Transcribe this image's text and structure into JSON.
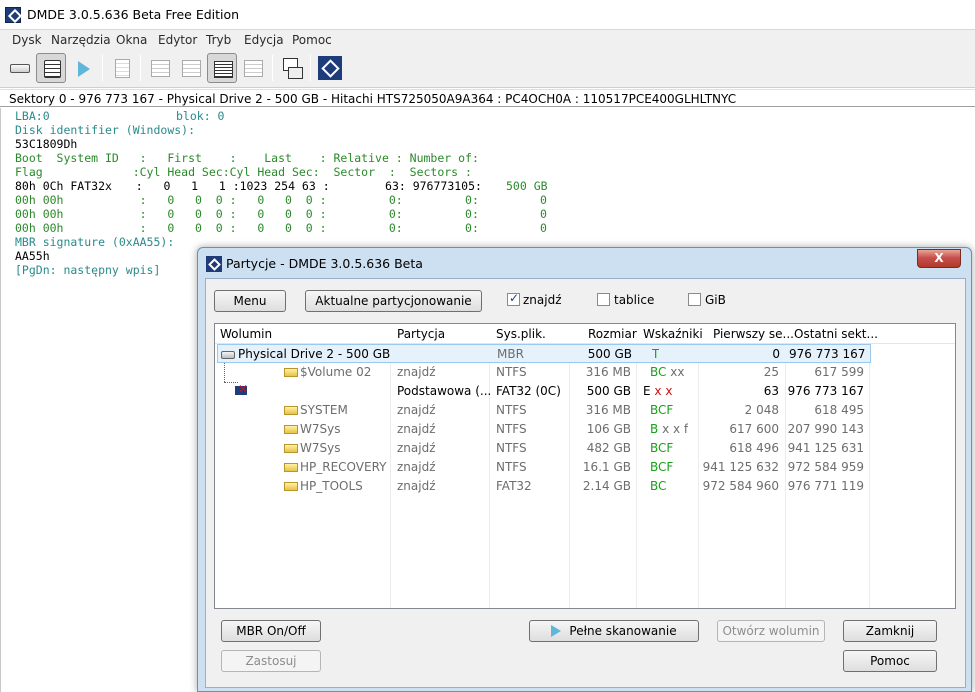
{
  "window": {
    "title": "DMDE 3.0.5.636 Beta Free Edition"
  },
  "menu": [
    "Dysk",
    "Narzędzia",
    "Okna",
    "Edytor",
    "Tryb",
    "Edycja",
    "Pomoc"
  ],
  "toolbar": {
    "icons": [
      "drive-icon",
      "view-lines-icon",
      "play-icon",
      "document-icon",
      "grid-icon",
      "grid-icon",
      "table-view-icon",
      "search-grid-icon",
      "copy-icon",
      "dmde-logo-icon"
    ]
  },
  "sector_bar": "Sektory 0 - 976 773 167 - Physical Drive 2 - 500 GB - Hitachi HTS725050A9A364 : PC4OCH0A : 110517PCE400GLHLTNYC",
  "hex": {
    "l1a": "LBA:0",
    "l1b": "blok: 0",
    "l2": "Disk identifier (Windows):",
    "l3": "53C1809Dh",
    "l4": "Boot  System ID   :   First    :    Last    : Relative : Number of:",
    "l5": "Flag             :Cyl Head Sec:Cyl Head Sec:  Sector  :  Sectors :",
    "l6a": "80h 0Ch FAT32x",
    "l6b": "   :   0   1   1 :1023 254 63 :        63: 976773105:",
    "l6c": "500 GB",
    "l7": "00h 00h           :   0   0  0 :   0   0  0 :         0:         0:",
    "l7c": "0",
    "l8": "00h 00h           :   0   0  0 :   0   0  0 :         0:         0:",
    "l8c": "0",
    "l9": "00h 00h           :   0   0  0 :   0   0  0 :         0:         0:",
    "l9c": "0",
    "l10": "MBR signature (0xAA55):",
    "l11": "AA55h",
    "l12": "[PgDn: następny wpis]"
  },
  "dialog": {
    "title": "Partycje - DMDE 3.0.5.636 Beta",
    "close": "X",
    "menu_btn": "Menu",
    "current_btn": "Aktualne partycjonowanie",
    "chk_find": {
      "label": "znajdź",
      "checked": true
    },
    "chk_tables": {
      "label": "tablice",
      "checked": false
    },
    "chk_gib": {
      "label": "GiB",
      "checked": false
    },
    "columns": [
      "Wolumin",
      "Partycja",
      "Sys.plik.",
      "Rozmiar",
      "Wskaźniki",
      "Pierwszy se...",
      "Ostatni sekt..."
    ],
    "rows": [
      {
        "vol": "Physical Drive 2 - 500 GB - ...",
        "part": "",
        "fs": "MBR",
        "size": "500 GB",
        "flags": "T",
        "first": "0",
        "last": "976 773 167"
      },
      {
        "vol": "$Volume 02",
        "part": "znajdź",
        "fs": "NTFS",
        "size": "316 MB",
        "flags": "BC",
        "flags2": "xx",
        "first": "25",
        "last": "617 599"
      },
      {
        "vol": "",
        "part": "Podstawowa (...",
        "fs": "FAT32 (0C)",
        "size": "500 GB",
        "flags": "E",
        "flags2": "x x",
        "first": "63",
        "last": "976 773 167"
      },
      {
        "vol": "SYSTEM",
        "part": "znajdź",
        "fs": "NTFS",
        "size": "316 MB",
        "flags": "BCF",
        "first": "2 048",
        "last": "618 495"
      },
      {
        "vol": "W7Sys",
        "part": "znajdź",
        "fs": "NTFS",
        "size": "106 GB",
        "flags": "B",
        "flags2": "x x f",
        "first": "617 600",
        "last": "207 990 143"
      },
      {
        "vol": "W7Sys",
        "part": "znajdź",
        "fs": "NTFS",
        "size": "482 GB",
        "flags": "BCF",
        "first": "618 496",
        "last": "941 125 631"
      },
      {
        "vol": "HP_RECOVERY",
        "part": "znajdź",
        "fs": "NTFS",
        "size": "16.1 GB",
        "flags": "BCF",
        "first": "941 125 632",
        "last": "972 584 959"
      },
      {
        "vol": "HP_TOOLS",
        "part": "znajdź",
        "fs": "FAT32",
        "size": "2.14 GB",
        "flags": "BC",
        "first": "972 584 960",
        "last": "976 771 119"
      }
    ],
    "mbr_btn": "MBR On/Off",
    "apply_btn": "Zastosuj",
    "scan_btn": "Pełne skanowanie",
    "open_btn": "Otwórz wolumin",
    "close_btn": "Zamknij",
    "help_btn": "Pomoc"
  },
  "colors": {
    "accent": "#1e3c7a",
    "teal": "#2a8a8a",
    "green": "#2a8a2a",
    "flag_green": "#1aa01a",
    "flag_red": "#d01010"
  }
}
